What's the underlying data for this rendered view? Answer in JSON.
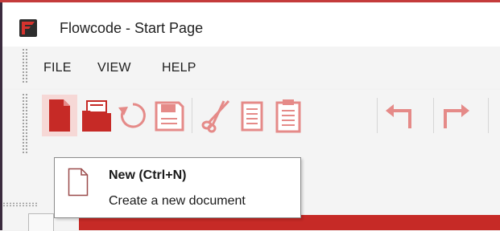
{
  "window": {
    "title": "Flowcode - Start Page",
    "app_icon_text": "FC"
  },
  "menu": {
    "items": [
      "FILE",
      "VIEW",
      "HELP"
    ]
  },
  "toolbar": {
    "buttons": [
      {
        "name": "new",
        "icon": "new-file-icon"
      },
      {
        "name": "open",
        "icon": "open-folder-icon"
      },
      {
        "name": "reload",
        "icon": "reload-icon"
      },
      {
        "name": "save",
        "icon": "save-icon"
      },
      {
        "name": "cut",
        "icon": "scissors-icon"
      },
      {
        "name": "copy",
        "icon": "copy-icon"
      },
      {
        "name": "paste",
        "icon": "paste-icon"
      },
      {
        "name": "undo",
        "icon": "undo-arrow-icon"
      },
      {
        "name": "redo",
        "icon": "redo-arrow-icon"
      }
    ],
    "active": "new"
  },
  "tooltip": {
    "title": "New (Ctrl+N)",
    "description": "Create a new document"
  },
  "colors": {
    "accent": "#c62a26",
    "icon_light": "#e58a88",
    "highlight": "#f6d8d6"
  }
}
